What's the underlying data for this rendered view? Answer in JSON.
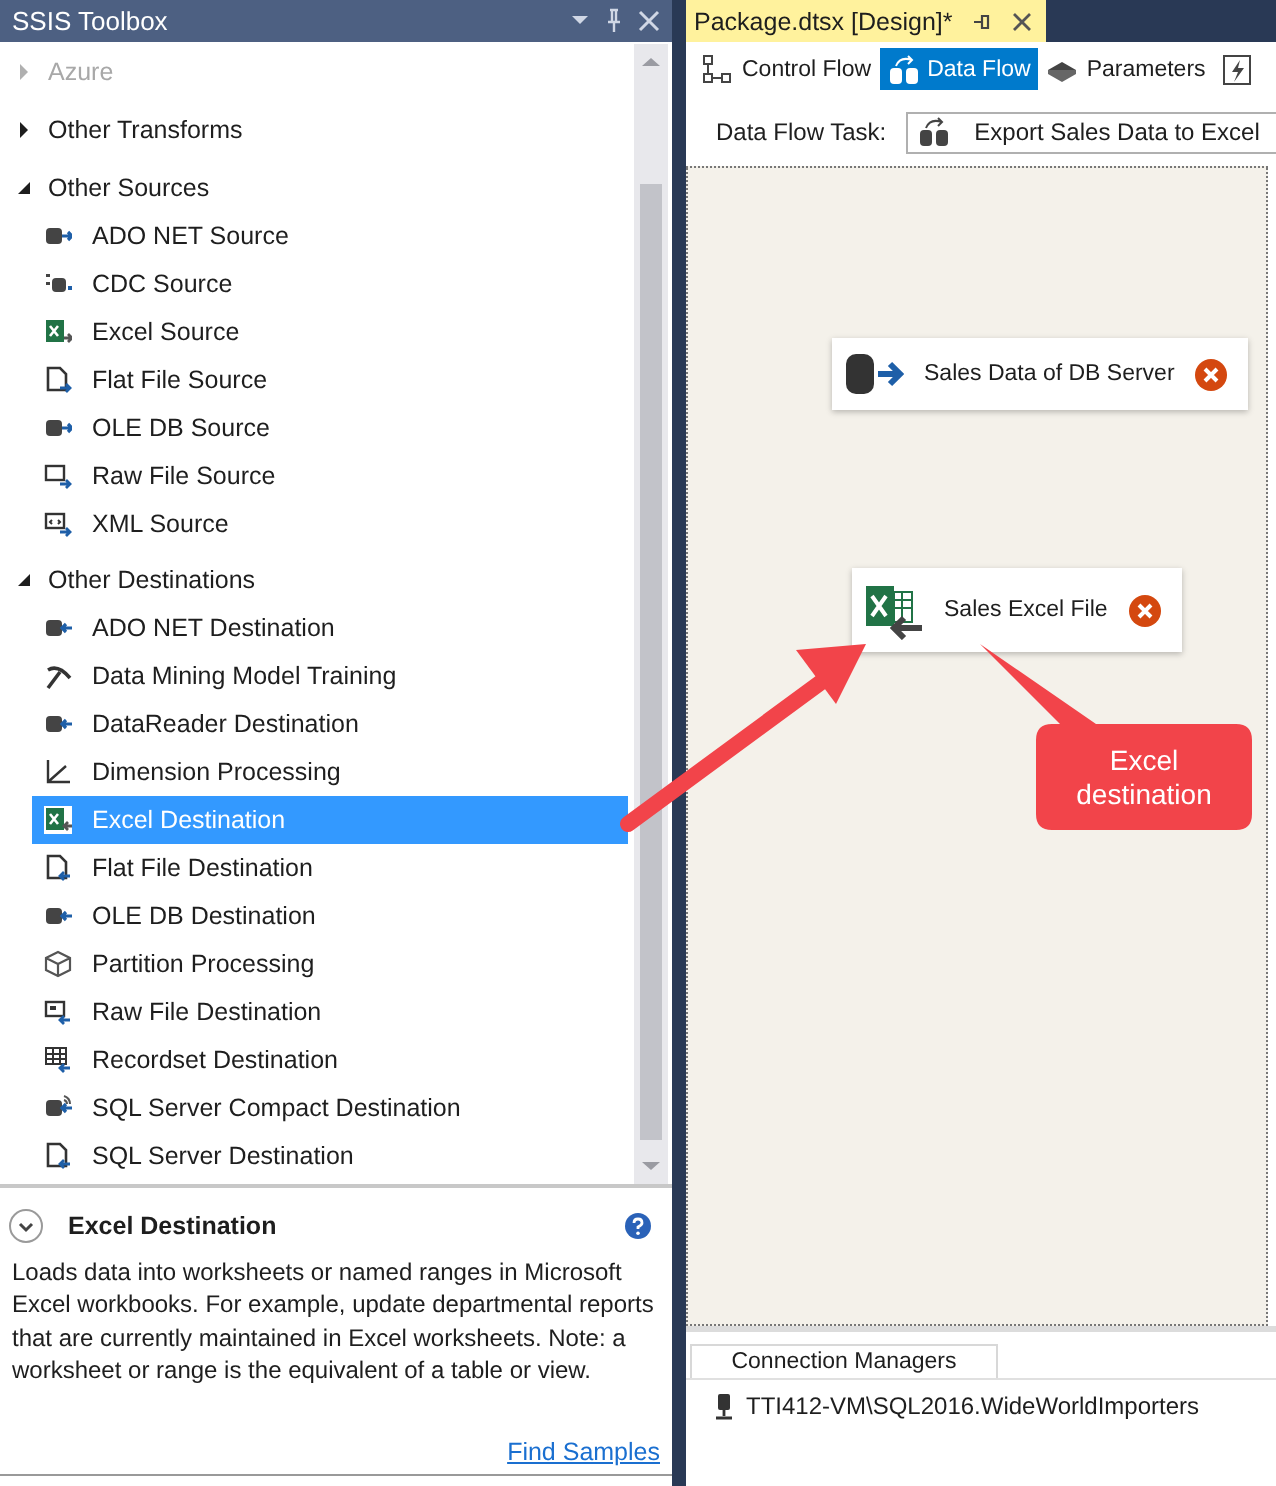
{
  "toolbox": {
    "title": "SSIS Toolbox",
    "groups": [
      {
        "label": "Azure",
        "expanded": false,
        "disabled": true
      },
      {
        "label": "Other Transforms",
        "expanded": false,
        "disabled": false
      },
      {
        "label": "Other Sources",
        "expanded": true,
        "disabled": false,
        "items": [
          {
            "label": "ADO NET Source",
            "kind": "db-out",
            "selected": false
          },
          {
            "label": "CDC Source",
            "kind": "cdc",
            "selected": false
          },
          {
            "label": "Excel Source",
            "kind": "excel-out",
            "selected": false
          },
          {
            "label": "Flat File Source",
            "kind": "file-out",
            "selected": false
          },
          {
            "label": "OLE DB Source",
            "kind": "db-out",
            "selected": false
          },
          {
            "label": "Raw File Source",
            "kind": "raw-out",
            "selected": false
          },
          {
            "label": "XML Source",
            "kind": "xml-out",
            "selected": false
          }
        ]
      },
      {
        "label": "Other Destinations",
        "expanded": true,
        "disabled": false,
        "items": [
          {
            "label": "ADO NET Destination",
            "kind": "db-in",
            "selected": false
          },
          {
            "label": "Data Mining Model Training",
            "kind": "pick",
            "selected": false
          },
          {
            "label": "DataReader Destination",
            "kind": "db-in",
            "selected": false
          },
          {
            "label": "Dimension Processing",
            "kind": "axis",
            "selected": false
          },
          {
            "label": "Excel Destination",
            "kind": "excel-in",
            "selected": true
          },
          {
            "label": "Flat File Destination",
            "kind": "file-in",
            "selected": false
          },
          {
            "label": "OLE DB Destination",
            "kind": "db-in",
            "selected": false
          },
          {
            "label": "Partition Processing",
            "kind": "cube",
            "selected": false
          },
          {
            "label": "Raw File Destination",
            "kind": "raw-in",
            "selected": false
          },
          {
            "label": "Recordset Destination",
            "kind": "grid-in",
            "selected": false
          },
          {
            "label": "SQL Server Compact Destination",
            "kind": "compact-in",
            "selected": false
          },
          {
            "label": "SQL Server Destination",
            "kind": "file-in",
            "selected": false
          }
        ]
      }
    ]
  },
  "description": {
    "title": "Excel Destination",
    "text": "Loads data into worksheets or named ranges in Microsoft Excel workbooks. For example, update departmental reports that are currently maintained in Excel worksheets. Note: a worksheet or range is the equivalent of a table or view.",
    "link": "Find Samples"
  },
  "document_tab": {
    "title": "Package.dtsx [Design]*"
  },
  "designer_tabs": [
    {
      "label": "Control Flow",
      "kind": "control",
      "selected": false
    },
    {
      "label": "Data Flow",
      "kind": "dataflow",
      "selected": true
    },
    {
      "label": "Parameters",
      "kind": "params",
      "selected": false
    },
    {
      "kind": "events",
      "selected": false
    }
  ],
  "task_selector": {
    "label": "Data Flow Task:",
    "value": "Export Sales Data to Excel"
  },
  "components": [
    {
      "name": "Sales Data of DB Server",
      "kind": "source",
      "error": true
    },
    {
      "name": "Sales Excel File",
      "kind": "excel",
      "error": true
    }
  ],
  "annotation": {
    "text": "Excel destination"
  },
  "connection_managers": {
    "tab": "Connection Managers",
    "items": [
      "TTI412-VM\\SQL2016.WideWorldImporters"
    ]
  }
}
